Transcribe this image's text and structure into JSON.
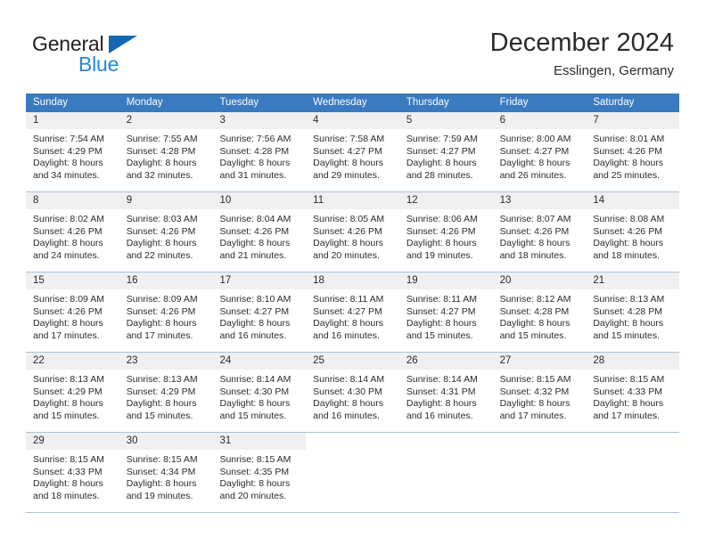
{
  "brand": {
    "name_part1": "General",
    "name_part2": "Blue",
    "triangle_color": "#1668b3",
    "part2_color": "#2389d4"
  },
  "header": {
    "title": "December 2024",
    "subtitle": "Esslingen, Germany"
  },
  "theme": {
    "header_row_bg": "#3a7ac0",
    "header_row_text": "#ffffff",
    "daynum_bg": "#f0f0f0",
    "grid_line": "#a9c3de",
    "body_text": "#2b2b2b"
  },
  "weekdays": [
    "Sunday",
    "Monday",
    "Tuesday",
    "Wednesday",
    "Thursday",
    "Friday",
    "Saturday"
  ],
  "weeks": [
    [
      {
        "day": "1",
        "lines": [
          "Sunrise: 7:54 AM",
          "Sunset: 4:29 PM",
          "Daylight: 8 hours",
          "and 34 minutes."
        ]
      },
      {
        "day": "2",
        "lines": [
          "Sunrise: 7:55 AM",
          "Sunset: 4:28 PM",
          "Daylight: 8 hours",
          "and 32 minutes."
        ]
      },
      {
        "day": "3",
        "lines": [
          "Sunrise: 7:56 AM",
          "Sunset: 4:28 PM",
          "Daylight: 8 hours",
          "and 31 minutes."
        ]
      },
      {
        "day": "4",
        "lines": [
          "Sunrise: 7:58 AM",
          "Sunset: 4:27 PM",
          "Daylight: 8 hours",
          "and 29 minutes."
        ]
      },
      {
        "day": "5",
        "lines": [
          "Sunrise: 7:59 AM",
          "Sunset: 4:27 PM",
          "Daylight: 8 hours",
          "and 28 minutes."
        ]
      },
      {
        "day": "6",
        "lines": [
          "Sunrise: 8:00 AM",
          "Sunset: 4:27 PM",
          "Daylight: 8 hours",
          "and 26 minutes."
        ]
      },
      {
        "day": "7",
        "lines": [
          "Sunrise: 8:01 AM",
          "Sunset: 4:26 PM",
          "Daylight: 8 hours",
          "and 25 minutes."
        ]
      }
    ],
    [
      {
        "day": "8",
        "lines": [
          "Sunrise: 8:02 AM",
          "Sunset: 4:26 PM",
          "Daylight: 8 hours",
          "and 24 minutes."
        ]
      },
      {
        "day": "9",
        "lines": [
          "Sunrise: 8:03 AM",
          "Sunset: 4:26 PM",
          "Daylight: 8 hours",
          "and 22 minutes."
        ]
      },
      {
        "day": "10",
        "lines": [
          "Sunrise: 8:04 AM",
          "Sunset: 4:26 PM",
          "Daylight: 8 hours",
          "and 21 minutes."
        ]
      },
      {
        "day": "11",
        "lines": [
          "Sunrise: 8:05 AM",
          "Sunset: 4:26 PM",
          "Daylight: 8 hours",
          "and 20 minutes."
        ]
      },
      {
        "day": "12",
        "lines": [
          "Sunrise: 8:06 AM",
          "Sunset: 4:26 PM",
          "Daylight: 8 hours",
          "and 19 minutes."
        ]
      },
      {
        "day": "13",
        "lines": [
          "Sunrise: 8:07 AM",
          "Sunset: 4:26 PM",
          "Daylight: 8 hours",
          "and 18 minutes."
        ]
      },
      {
        "day": "14",
        "lines": [
          "Sunrise: 8:08 AM",
          "Sunset: 4:26 PM",
          "Daylight: 8 hours",
          "and 18 minutes."
        ]
      }
    ],
    [
      {
        "day": "15",
        "lines": [
          "Sunrise: 8:09 AM",
          "Sunset: 4:26 PM",
          "Daylight: 8 hours",
          "and 17 minutes."
        ]
      },
      {
        "day": "16",
        "lines": [
          "Sunrise: 8:09 AM",
          "Sunset: 4:26 PM",
          "Daylight: 8 hours",
          "and 17 minutes."
        ]
      },
      {
        "day": "17",
        "lines": [
          "Sunrise: 8:10 AM",
          "Sunset: 4:27 PM",
          "Daylight: 8 hours",
          "and 16 minutes."
        ]
      },
      {
        "day": "18",
        "lines": [
          "Sunrise: 8:11 AM",
          "Sunset: 4:27 PM",
          "Daylight: 8 hours",
          "and 16 minutes."
        ]
      },
      {
        "day": "19",
        "lines": [
          "Sunrise: 8:11 AM",
          "Sunset: 4:27 PM",
          "Daylight: 8 hours",
          "and 15 minutes."
        ]
      },
      {
        "day": "20",
        "lines": [
          "Sunrise: 8:12 AM",
          "Sunset: 4:28 PM",
          "Daylight: 8 hours",
          "and 15 minutes."
        ]
      },
      {
        "day": "21",
        "lines": [
          "Sunrise: 8:13 AM",
          "Sunset: 4:28 PM",
          "Daylight: 8 hours",
          "and 15 minutes."
        ]
      }
    ],
    [
      {
        "day": "22",
        "lines": [
          "Sunrise: 8:13 AM",
          "Sunset: 4:29 PM",
          "Daylight: 8 hours",
          "and 15 minutes."
        ]
      },
      {
        "day": "23",
        "lines": [
          "Sunrise: 8:13 AM",
          "Sunset: 4:29 PM",
          "Daylight: 8 hours",
          "and 15 minutes."
        ]
      },
      {
        "day": "24",
        "lines": [
          "Sunrise: 8:14 AM",
          "Sunset: 4:30 PM",
          "Daylight: 8 hours",
          "and 15 minutes."
        ]
      },
      {
        "day": "25",
        "lines": [
          "Sunrise: 8:14 AM",
          "Sunset: 4:30 PM",
          "Daylight: 8 hours",
          "and 16 minutes."
        ]
      },
      {
        "day": "26",
        "lines": [
          "Sunrise: 8:14 AM",
          "Sunset: 4:31 PM",
          "Daylight: 8 hours",
          "and 16 minutes."
        ]
      },
      {
        "day": "27",
        "lines": [
          "Sunrise: 8:15 AM",
          "Sunset: 4:32 PM",
          "Daylight: 8 hours",
          "and 17 minutes."
        ]
      },
      {
        "day": "28",
        "lines": [
          "Sunrise: 8:15 AM",
          "Sunset: 4:33 PM",
          "Daylight: 8 hours",
          "and 17 minutes."
        ]
      }
    ],
    [
      {
        "day": "29",
        "lines": [
          "Sunrise: 8:15 AM",
          "Sunset: 4:33 PM",
          "Daylight: 8 hours",
          "and 18 minutes."
        ]
      },
      {
        "day": "30",
        "lines": [
          "Sunrise: 8:15 AM",
          "Sunset: 4:34 PM",
          "Daylight: 8 hours",
          "and 19 minutes."
        ]
      },
      {
        "day": "31",
        "lines": [
          "Sunrise: 8:15 AM",
          "Sunset: 4:35 PM",
          "Daylight: 8 hours",
          "and 20 minutes."
        ]
      },
      {
        "day": "",
        "lines": []
      },
      {
        "day": "",
        "lines": []
      },
      {
        "day": "",
        "lines": []
      },
      {
        "day": "",
        "lines": []
      }
    ]
  ]
}
